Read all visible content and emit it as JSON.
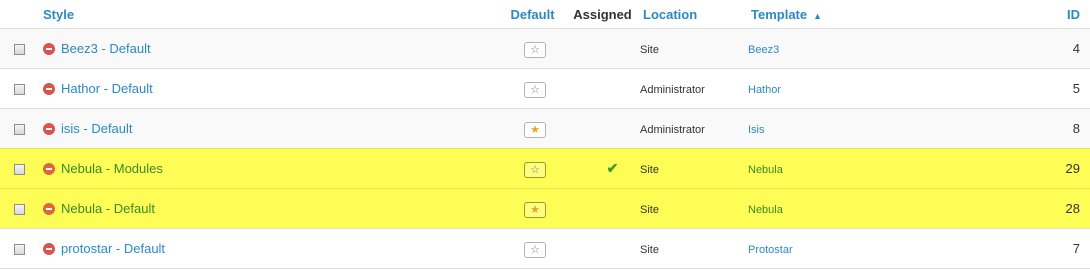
{
  "header": {
    "style": "Style",
    "default": "Default",
    "assigned": "Assigned",
    "location": "Location",
    "template": "Template",
    "sort_indicator": "▲",
    "id": "ID"
  },
  "icons": {
    "default_star": "★",
    "not_default_star": "☆",
    "assigned_check": "✔"
  },
  "colors": {
    "link": "#2a8ac6",
    "highlight": "#fdfd55",
    "unpublished": "#d9534f",
    "default_star": "#f0a020",
    "assigned_check": "#3c9a30"
  },
  "rows": [
    {
      "style": "Beez3 - Default",
      "is_default": false,
      "assigned": false,
      "location": "Site",
      "template": "Beez3",
      "id": "4",
      "highlighted": false
    },
    {
      "style": "Hathor - Default",
      "is_default": false,
      "assigned": false,
      "location": "Administrator",
      "template": "Hathor",
      "id": "5",
      "highlighted": false
    },
    {
      "style": "isis - Default",
      "is_default": true,
      "assigned": false,
      "location": "Administrator",
      "template": "Isis",
      "id": "8",
      "highlighted": false
    },
    {
      "style": "Nebula - Modules",
      "is_default": false,
      "assigned": true,
      "location": "Site",
      "template": "Nebula",
      "id": "29",
      "highlighted": true
    },
    {
      "style": "Nebula - Default",
      "is_default": true,
      "assigned": false,
      "location": "Site",
      "template": "Nebula",
      "id": "28",
      "highlighted": true
    },
    {
      "style": "protostar - Default",
      "is_default": false,
      "assigned": false,
      "location": "Site",
      "template": "Protostar",
      "id": "7",
      "highlighted": false
    }
  ]
}
